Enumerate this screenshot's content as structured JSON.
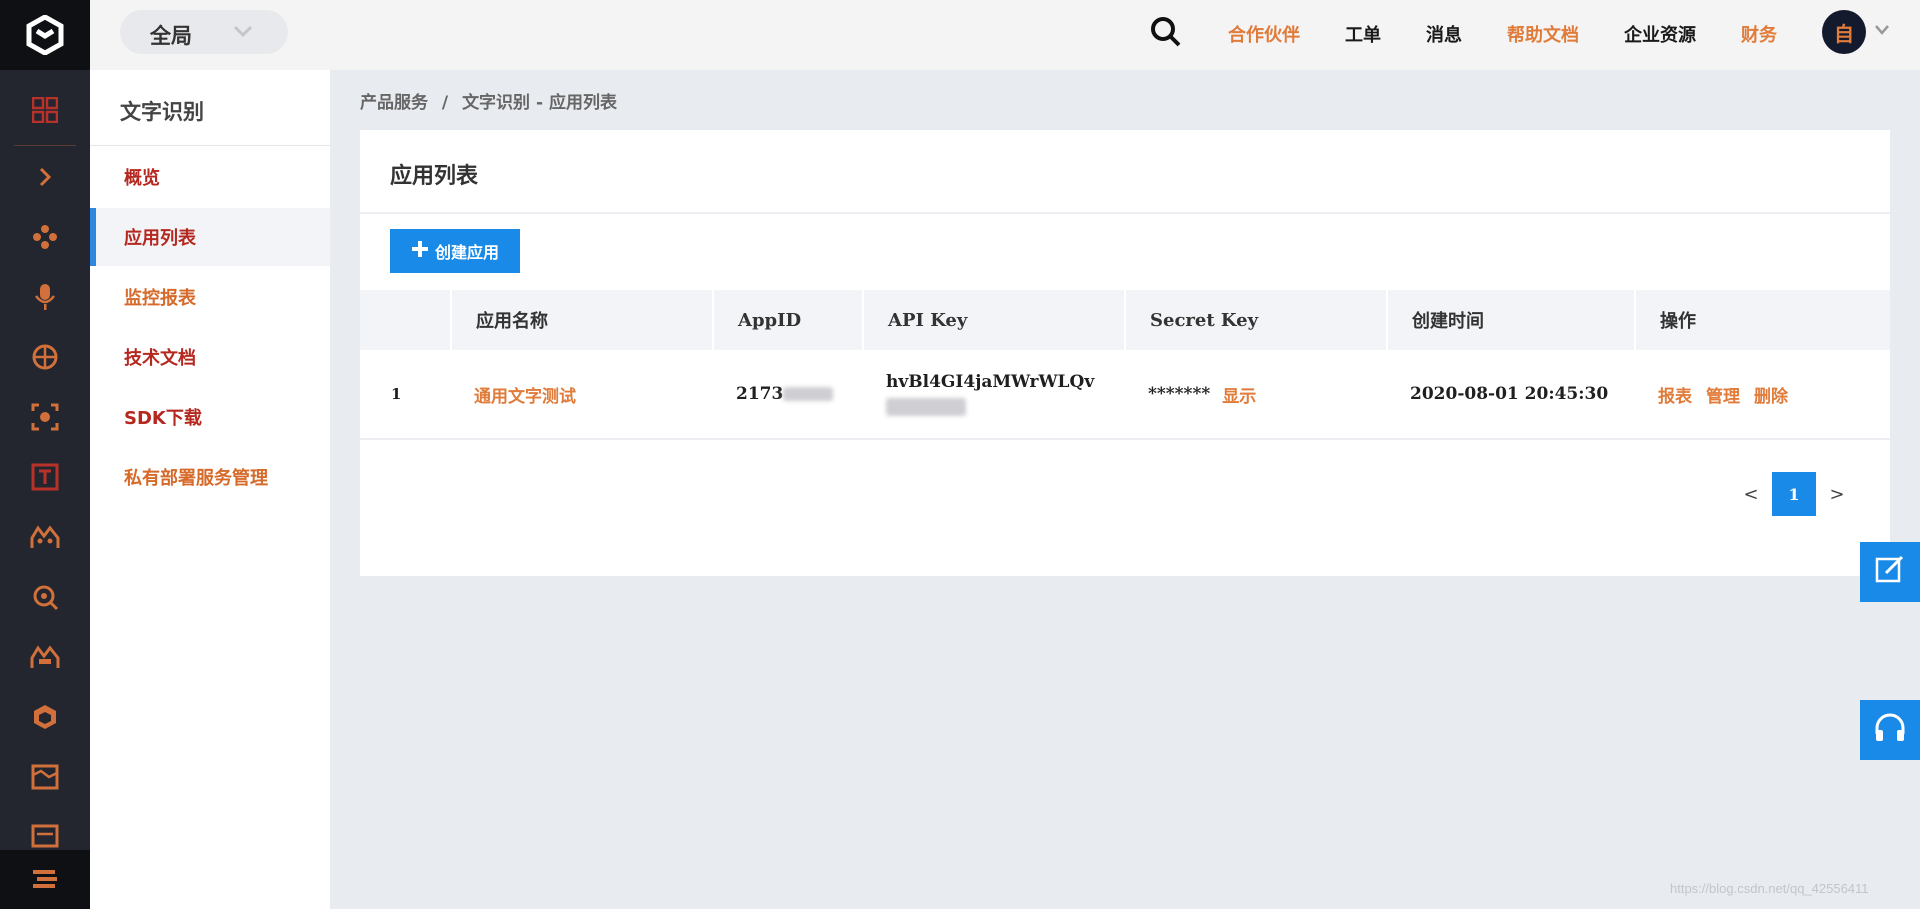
{
  "topbar": {
    "scope": "全局",
    "nav": [
      "合作伙伴",
      "工单",
      "消息",
      "帮助文档",
      "企业资源",
      "财务"
    ],
    "avatar_text": "自"
  },
  "subnav": {
    "title": "文字识别",
    "items": [
      "概览",
      "应用列表",
      "监控报表",
      "技术文档",
      "SDK下载",
      "私有部署服务管理"
    ]
  },
  "breadcrumb": [
    "产品服务",
    "/",
    "文字识别 - 应用列表"
  ],
  "main": {
    "title": "应用列表",
    "create_button": "创建应用",
    "columns": [
      "应用名称",
      "AppID",
      "API Key",
      "Secret Key",
      "创建时间",
      "操作"
    ],
    "rows": [
      {
        "index": "1",
        "name": "通用文字测试",
        "appid_prefix": "2173",
        "api_key": "hvBl4GI4jaMWrWLQv",
        "secret_key": "*******",
        "secret_show": "显示",
        "created": "2020-08-01 20:45:30",
        "actions": [
          "报表",
          "管理",
          "删除"
        ]
      }
    ]
  },
  "pagination": {
    "prev": "<",
    "current": "1",
    "next": ">"
  },
  "watermark": "https://blog.csdn.net/qq_42556411",
  "colors": {
    "accent": "#1a8ae8",
    "link": "#e07b3a",
    "rail": "#23262e"
  }
}
